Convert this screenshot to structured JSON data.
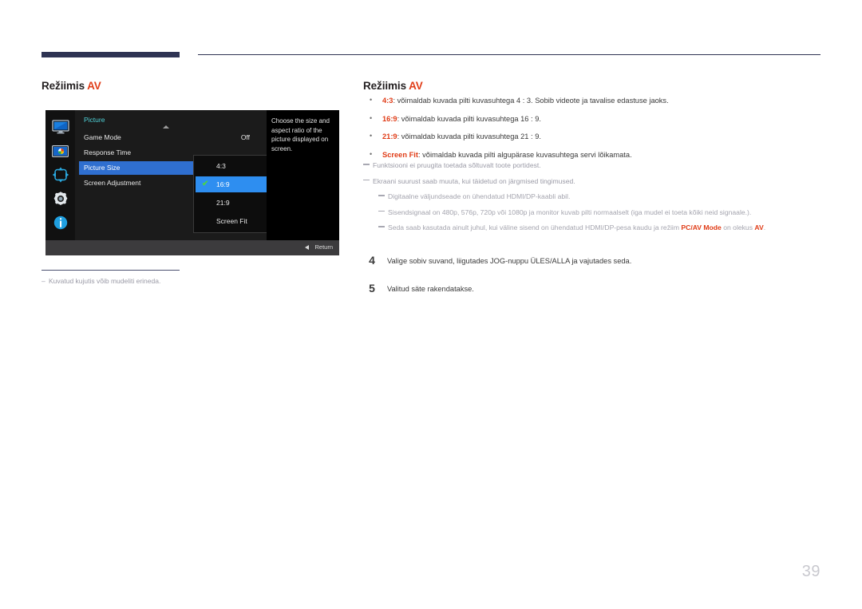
{
  "heading_left": {
    "text": "Režiimis ",
    "accent": "AV"
  },
  "heading_right": {
    "text": "Režiimis ",
    "accent": "AV"
  },
  "colors": {
    "accent_red": "#e03c17",
    "rule_navy": "#2e3353",
    "osd_select_blue": "#2f6fd0",
    "osd_dropdown_blue": "#2e8ef0",
    "osd_title_cyan": "#4fd2d8",
    "osd_check_green": "#4ad34a",
    "note_gray": "#9a9aa6"
  },
  "osd": {
    "title": "Picture",
    "sidebar_icons": [
      "monitor-icon",
      "picture-color-icon",
      "screen-adjust-arrows-icon",
      "gear-settings-icon",
      "info-icon"
    ],
    "rows": [
      {
        "label": "Game Mode",
        "value": "Off",
        "selected": false
      },
      {
        "label": "Response Time",
        "value": "",
        "selected": false
      },
      {
        "label": "Picture Size",
        "value": "",
        "selected": true
      },
      {
        "label": "Screen Adjustment",
        "value": "",
        "selected": false
      }
    ],
    "dropdown": [
      {
        "label": "4:3",
        "checked": false
      },
      {
        "label": "16:9",
        "checked": true
      },
      {
        "label": "21:9",
        "checked": false
      },
      {
        "label": "Screen Fit",
        "checked": false
      }
    ],
    "help_text": "Choose the size and aspect ratio of the picture displayed on screen.",
    "return_label": "Return",
    "check_glyph": "✔"
  },
  "caption_note": "Kuvatud kujutis võib mudeliti erineda.",
  "bullets": [
    {
      "term": "4:3",
      "rest": ": võimaldab kuvada pilti kuvasuhtega 4 : 3. Sobib videote ja tavalise edastuse jaoks."
    },
    {
      "term": "16:9",
      "rest": ": võimaldab kuvada pilti kuvasuhtega 16 : 9."
    },
    {
      "term": "21:9",
      "rest": ": võimaldab kuvada pilti kuvasuhtega 21 : 9."
    },
    {
      "term": "Screen Fit",
      "rest": ": võimaldab kuvada pilti algupärase kuvasuhtega servi lõikamata."
    }
  ],
  "notes": [
    {
      "level": 1,
      "text": "Funktsiooni ei pruugita toetada sõltuvalt toote portidest."
    },
    {
      "level": 1,
      "text": "Ekraani suurust saab muuta, kui täidetud on järgmised tingimused."
    },
    {
      "level": 2,
      "text": "Digitaalne väljundseade on ühendatud HDMI/DP-kaabli abil."
    },
    {
      "level": 2,
      "text": "Sisendsignaal on 480p, 576p, 720p või 1080p ja monitor kuvab pilti normaalselt (iga mudel ei toeta kõiki neid signaale.)."
    },
    {
      "level": 2,
      "text": "Seda saab kasutada ainult juhul, kui väline sisend on ühendatud HDMI/DP-pesa kaudu ja režiim ",
      "strong1": "PC/AV Mode",
      "text2": " on olekus ",
      "strong2": "AV",
      "text3": "."
    }
  ],
  "steps": [
    {
      "num": "4",
      "text": "Valige sobiv suvand, liigutades JOG-nuppu ÜLES/ALLA ja vajutades seda."
    },
    {
      "num": "5",
      "text": "Valitud säte rakendatakse."
    }
  ],
  "page_number": "39"
}
